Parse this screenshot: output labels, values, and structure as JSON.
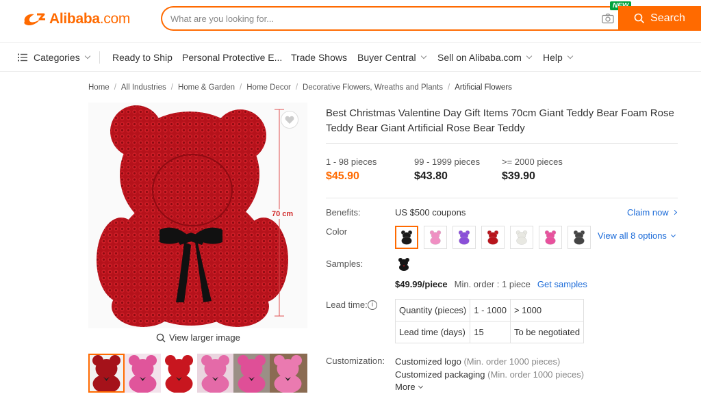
{
  "header": {
    "logo_brand": "Alibaba",
    "logo_suffix": ".com",
    "search_placeholder": "What are you looking for...",
    "search_button_label": "Search",
    "new_badge": "NEW"
  },
  "nav": {
    "items": [
      {
        "label": "Categories"
      },
      {
        "label": "Ready to Ship"
      },
      {
        "label": "Personal Protective E..."
      },
      {
        "label": "Trade Shows"
      },
      {
        "label": "Buyer Central"
      },
      {
        "label": "Sell on Alibaba.com"
      },
      {
        "label": "Help"
      }
    ]
  },
  "breadcrumb": [
    "Home",
    "All Industries",
    "Home & Garden",
    "Home Decor",
    "Decorative Flowers, Wreaths and Plants",
    "Artificial Flowers"
  ],
  "gallery": {
    "size_label": "70 cm",
    "view_larger": "View larger image",
    "main_color": "#b5121b",
    "thumbs": [
      {
        "color": "#a5121a",
        "bg": "#f2f2f2"
      },
      {
        "color": "#e0559b",
        "bg": "#f3e3ec"
      },
      {
        "color": "#c8161f",
        "bg": "#ffffff"
      },
      {
        "color": "#e46aa8",
        "bg": "#ead5df"
      },
      {
        "color": "#df4f97",
        "bg": "#9b8f86"
      },
      {
        "color": "#ea7ab0",
        "bg": "#8a6b52"
      }
    ]
  },
  "product": {
    "title": "Best Christmas Valentine Day Gift Items 70cm Giant Teddy Bear Foam Rose Teddy Bear Giant Artificial Rose Bear Teddy",
    "prices": [
      {
        "range": "1 - 98 pieces",
        "price": "$45.90"
      },
      {
        "range": "99 - 1999 pieces",
        "price": "$43.80"
      },
      {
        "range": ">= 2000 pieces",
        "price": "$39.90"
      }
    ],
    "benefits_label": "Benefits:",
    "benefits_value": "US $500 coupons",
    "claim_now": "Claim now",
    "color_label": "Color",
    "color_swatches": [
      "#1a1a1a",
      "#f08fc3",
      "#8a4fd8",
      "#b8141c",
      "#e8e8e2",
      "#e8519d",
      "#444444"
    ],
    "view_all_options": "View all 8 options",
    "samples_label": "Samples:",
    "sample_price": "$49.99/piece",
    "sample_min_order": "Min. order : 1 piece",
    "get_samples": "Get samples",
    "lead_time_label": "Lead time:",
    "lead_table": {
      "row1": [
        "Quantity (pieces)",
        "1 - 1000",
        "> 1000"
      ],
      "row2": [
        "Lead time (days)",
        "15",
        "To be negotiated"
      ]
    },
    "customization_label": "Customization:",
    "customizations": [
      {
        "name": "Customized logo",
        "note": "(Min. order 1000 pieces)"
      },
      {
        "name": "Customized packaging",
        "note": "(Min. order 1000 pieces)"
      }
    ],
    "more": "More"
  }
}
